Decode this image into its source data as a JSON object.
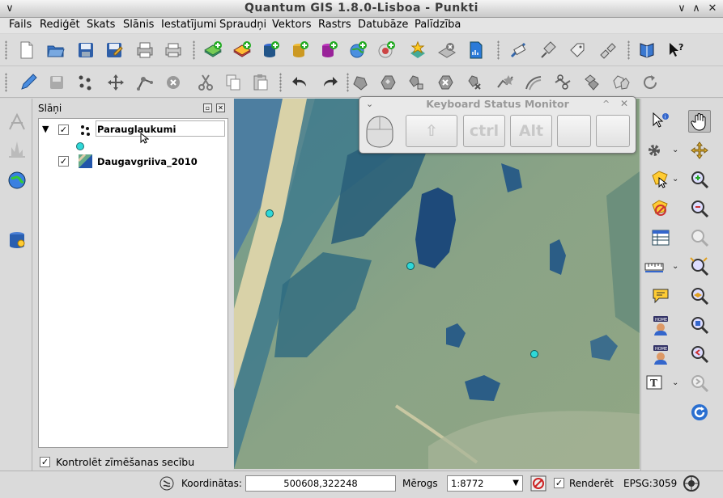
{
  "window": {
    "title": "Quantum GIS 1.8.0-Lisboa - Punkti",
    "menu_btn": "∨",
    "min_btn": "∨",
    "max_btn": "∧",
    "close_btn": "✕"
  },
  "menubar": {
    "items": [
      "Fails",
      "Rediģēt",
      "Skats",
      "Slānis",
      "Iestatījumi",
      "Spraudņi",
      "Vektors",
      "Rastrs",
      "Datubāze",
      "Palīdzība"
    ]
  },
  "layers_panel": {
    "title": "Slāņi",
    "layers": [
      {
        "name": "Parauglaukumi",
        "checked": "✓",
        "expander": "▼"
      },
      {
        "name": "Daugavgriiva_2010",
        "checked": "✓"
      }
    ],
    "render_order_checkbox": "✓",
    "render_order_label": "Kontrolēt zīmēšanas secību"
  },
  "keyboard_monitor": {
    "title": "Keyboard Status Monitor",
    "keys": [
      "⇧",
      "ctrl",
      "Alt",
      "",
      ""
    ]
  },
  "statusbar": {
    "coordinates_label": "Koordinātas:",
    "coordinates_value": "500608,322248",
    "scale_label": "Mērogs",
    "scale_value": "1:8772",
    "render_checkbox": "✓",
    "render_label": "Renderēt",
    "crs": "EPSG:3059"
  },
  "colors": {
    "point_marker": "#2fd8d8",
    "water": "#1e4a7a",
    "vegetation": "#7f9f86",
    "beach": "#d9d2a8"
  }
}
